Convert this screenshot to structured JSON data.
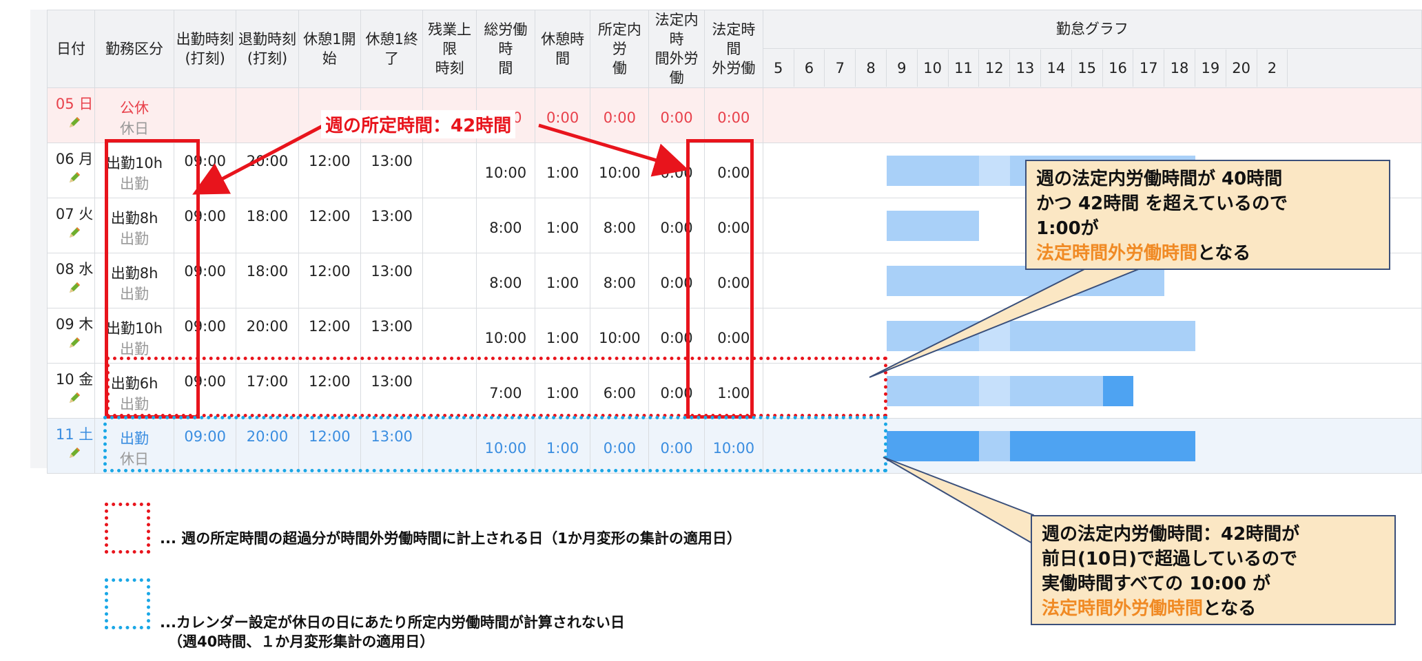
{
  "headers": {
    "date": "日付",
    "kubun": "勤務区分",
    "start_a": "出勤時刻",
    "start_b": "(打刻)",
    "end_a": "退勤時刻",
    "end_b": "(打刻)",
    "break_s_a": "休憩1開",
    "break_s_b": "始",
    "break_e_a": "休憩1終",
    "break_e_b": "了",
    "ot_limit_a": "残業上限",
    "ot_limit_b": "時刻",
    "total_a": "総労働時",
    "total_b": "間",
    "break_time": "休憩時間",
    "shotei_a": "所定内労",
    "shotei_b": "働",
    "houtei_in_a": "法定内時",
    "houtei_in_b": "間外労働",
    "houtei_out_a": "法定時間",
    "houtei_out_b": "外労働",
    "graph": "勤怠グラフ"
  },
  "hours": [
    "5",
    "6",
    "7",
    "8",
    "9",
    "10",
    "11",
    "12",
    "13",
    "14",
    "15",
    "16",
    "17",
    "18",
    "19",
    "20",
    "2"
  ],
  "rows": [
    {
      "date": "05  日",
      "kubun": "公休",
      "kubun_sub": "休日",
      "start": "",
      "end": "",
      "bs": "",
      "be": "",
      "limit": "",
      "total": "0:00",
      "brk": "0:00",
      "shotei": "0:00",
      "hin": "0:00",
      "hout": "0:00",
      "cls": "sun"
    },
    {
      "date": "06  月",
      "kubun": "出勤10h",
      "kubun_sub": "出勤",
      "start": "09:00",
      "end": "20:00",
      "bs": "12:00",
      "be": "13:00",
      "limit": "",
      "total": "10:00",
      "brk": "1:00",
      "shotei": "10:00",
      "hin": "0:00",
      "hout": "0:00",
      "cls": ""
    },
    {
      "date": "07  火",
      "kubun": "出勤8h",
      "kubun_sub": "出勤",
      "start": "09:00",
      "end": "18:00",
      "bs": "12:00",
      "be": "13:00",
      "limit": "",
      "total": "8:00",
      "brk": "1:00",
      "shotei": "8:00",
      "hin": "0:00",
      "hout": "0:00",
      "cls": ""
    },
    {
      "date": "08  水",
      "kubun": "出勤8h",
      "kubun_sub": "出勤",
      "start": "09:00",
      "end": "18:00",
      "bs": "12:00",
      "be": "13:00",
      "limit": "",
      "total": "8:00",
      "brk": "1:00",
      "shotei": "8:00",
      "hin": "0:00",
      "hout": "0:00",
      "cls": ""
    },
    {
      "date": "09  木",
      "kubun": "出勤10h",
      "kubun_sub": "出勤",
      "start": "09:00",
      "end": "20:00",
      "bs": "12:00",
      "be": "13:00",
      "limit": "",
      "total": "10:00",
      "brk": "1:00",
      "shotei": "10:00",
      "hin": "0:00",
      "hout": "0:00",
      "cls": ""
    },
    {
      "date": "10  金",
      "kubun": "出勤6h",
      "kubun_sub": "出勤",
      "start": "09:00",
      "end": "17:00",
      "bs": "12:00",
      "be": "13:00",
      "limit": "",
      "total": "7:00",
      "brk": "1:00",
      "shotei": "6:00",
      "hin": "0:00",
      "hout": "1:00",
      "cls": ""
    },
    {
      "date": "11  土",
      "kubun": "出勤",
      "kubun_sub": "休日",
      "start": "09:00",
      "end": "20:00",
      "bs": "12:00",
      "be": "13:00",
      "limit": "",
      "total": "10:00",
      "brk": "1:00",
      "shotei": "0:00",
      "hin": "0:00",
      "hout": "10:00",
      "cls": "sat"
    }
  ],
  "graph_bars": [
    [],
    [
      {
        "from": 9,
        "to": 12,
        "c": "#a9d0f8"
      },
      {
        "from": 12,
        "to": 13,
        "c": "#c6e0fb"
      },
      {
        "from": 13,
        "to": 19,
        "c": "#a9d0f8"
      }
    ],
    [
      {
        "from": 9,
        "to": 12,
        "c": "#a9d0f8"
      }
    ],
    [
      {
        "from": 9,
        "to": 18,
        "c": "#a9d0f8"
      }
    ],
    [
      {
        "from": 9,
        "to": 12,
        "c": "#a9d0f8"
      },
      {
        "from": 12,
        "to": 13,
        "c": "#c6e0fb"
      },
      {
        "from": 13,
        "to": 19,
        "c": "#a9d0f8"
      }
    ],
    [
      {
        "from": 9,
        "to": 12,
        "c": "#a9d0f8"
      },
      {
        "from": 12,
        "to": 13,
        "c": "#c6e0fb"
      },
      {
        "from": 13,
        "to": 16,
        "c": "#a9d0f8"
      },
      {
        "from": 16,
        "to": 17,
        "c": "#4ea3f2"
      }
    ],
    [
      {
        "from": 9,
        "to": 12,
        "c": "#4ea3f2"
      },
      {
        "from": 12,
        "to": 13,
        "c": "#a9d0f8"
      },
      {
        "from": 13,
        "to": 19,
        "c": "#4ea3f2"
      }
    ]
  ],
  "annotations": {
    "weekly_label": "週の所定時間：42時間",
    "callout1": {
      "line1": "週の法定内労働時間が 40時間",
      "line2": "かつ 42時間 を超えているので",
      "line3": "1:00が",
      "line4_orange": "法定時間外労働時間",
      "line4_rest": "となる"
    },
    "callout2": {
      "line1": "週の法定内労働時間：42時間が",
      "line2": "前日(10日)で超過しているので",
      "line3": "実働時間すべての 10:00 が",
      "line4_orange": "法定時間外労働時間",
      "line4_rest": "となる"
    },
    "legend_red": "... 週の所定時間の超過分が時間外労働時間に計上される日（1か月変形の集計の適用日）",
    "legend_blue_1": "...カレンダー設定が休日の日にあたり所定内労働時間が計算されない日",
    "legend_blue_2": "（週40時間、１か月変形集計の適用日）"
  },
  "colors": {
    "red": "#e8141c",
    "blue": "#1aa7e6",
    "sunday": "#e8414b",
    "saturday": "#3a8de0",
    "orange": "#f08a24",
    "callout_bg": "#fbe7c4"
  }
}
